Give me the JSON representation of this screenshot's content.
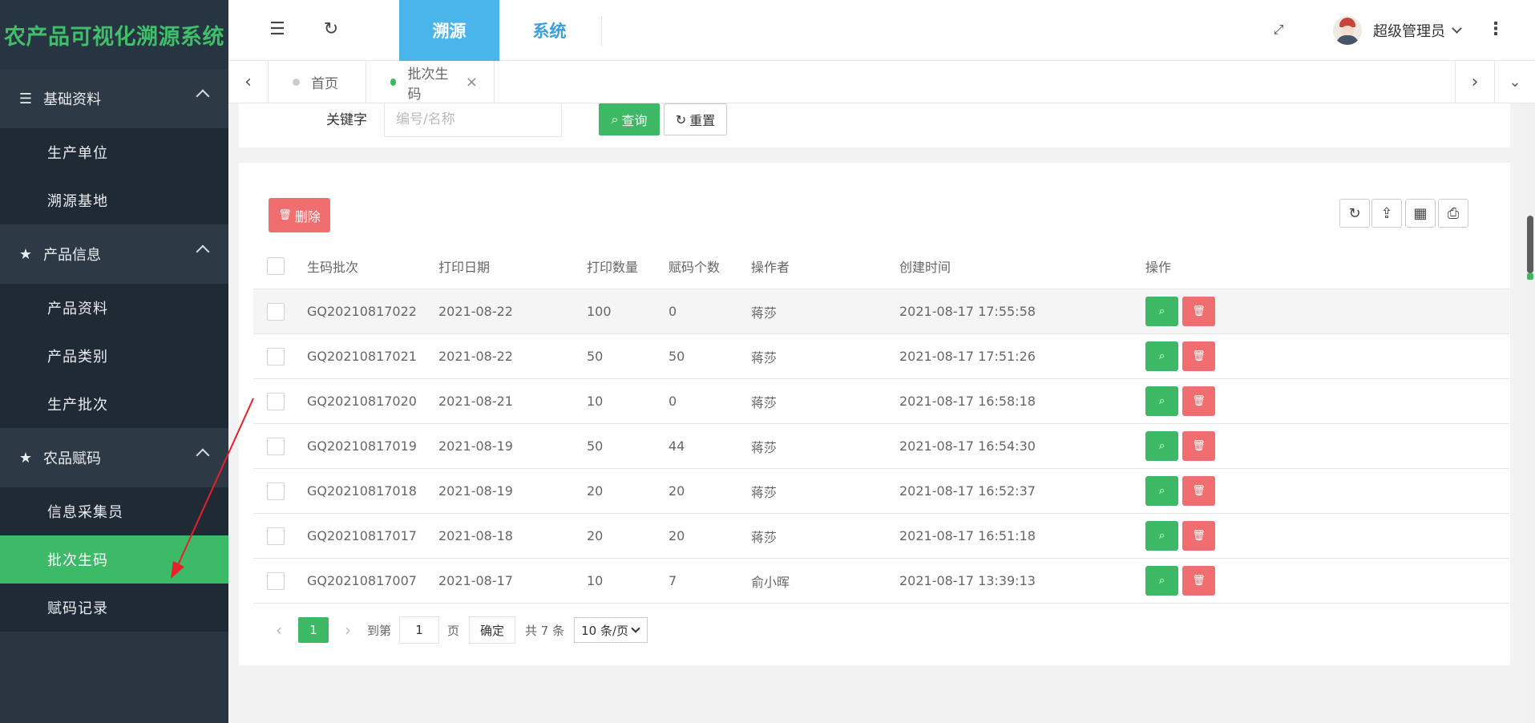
{
  "sidebar": {
    "logo": "农产品可视化溯源系统",
    "groups": [
      {
        "icon": "list-icon",
        "label": "基础资料",
        "items": [
          "生产单位",
          "溯源基地"
        ]
      },
      {
        "icon": "star-icon",
        "label": "产品信息",
        "items": [
          "产品资料",
          "产品类别",
          "生产批次"
        ]
      },
      {
        "icon": "star-icon",
        "label": "农品赋码",
        "items": [
          "信息采集员",
          "批次生码",
          "赋码记录"
        ]
      }
    ],
    "active_item": "批次生码"
  },
  "topbar": {
    "tabs": [
      "溯源",
      "系统"
    ],
    "active_tab": "溯源",
    "user_name": "超级管理员"
  },
  "page_tabs": [
    {
      "label": "首页",
      "active": false,
      "dot_color": "#cccccc"
    },
    {
      "label": "批次生码",
      "active": true,
      "dot_color": "#3db865",
      "close": "×"
    }
  ],
  "search": {
    "label": "关键字",
    "placeholder": "编号/名称",
    "search_button": "查询",
    "reset_button": "重置"
  },
  "toolbar": {
    "delete_button": "删除"
  },
  "table": {
    "columns": [
      "生码批次",
      "打印日期",
      "打印数量",
      "赋码个数",
      "操作者",
      "创建时间",
      "操作"
    ],
    "rows": [
      {
        "batch": "GQ20210817022",
        "print_date": "2021-08-22",
        "print_qty": "100",
        "coded": "0",
        "operator": "蒋莎",
        "created": "2021-08-17 17:55:58"
      },
      {
        "batch": "GQ20210817021",
        "print_date": "2021-08-22",
        "print_qty": "50",
        "coded": "50",
        "operator": "蒋莎",
        "created": "2021-08-17 17:51:26"
      },
      {
        "batch": "GQ20210817020",
        "print_date": "2021-08-21",
        "print_qty": "10",
        "coded": "0",
        "operator": "蒋莎",
        "created": "2021-08-17 16:58:18"
      },
      {
        "batch": "GQ20210817019",
        "print_date": "2021-08-19",
        "print_qty": "50",
        "coded": "44",
        "operator": "蒋莎",
        "created": "2021-08-17 16:54:30"
      },
      {
        "batch": "GQ20210817018",
        "print_date": "2021-08-19",
        "print_qty": "20",
        "coded": "20",
        "operator": "蒋莎",
        "created": "2021-08-17 16:52:37"
      },
      {
        "batch": "GQ20210817017",
        "print_date": "2021-08-18",
        "print_qty": "20",
        "coded": "20",
        "operator": "蒋莎",
        "created": "2021-08-17 16:51:18"
      },
      {
        "batch": "GQ20210817007",
        "print_date": "2021-08-17",
        "print_qty": "10",
        "coded": "7",
        "operator": "俞小晖",
        "created": "2021-08-17 13:39:13"
      }
    ]
  },
  "pagination": {
    "current_page": "1",
    "goto_label": "到第",
    "goto_value": "1",
    "page_unit": "页",
    "confirm": "确定",
    "total": "共 7 条",
    "page_size": "10 条/页"
  },
  "colors": {
    "accent_green": "#3db865",
    "danger_red": "#f06e70",
    "sidebar_bg": "#2a3541",
    "top_tab_blue": "#4ab5ea"
  }
}
